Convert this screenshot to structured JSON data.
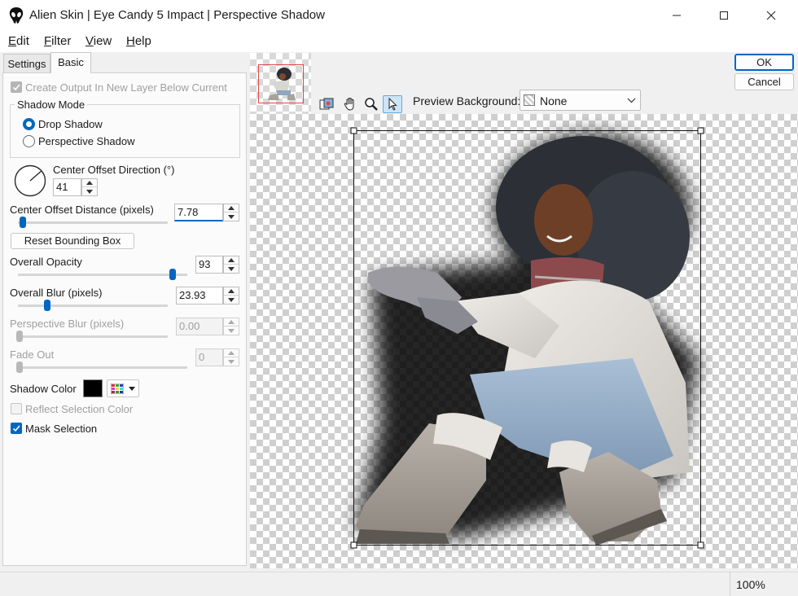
{
  "window": {
    "title": "Alien Skin | Eye Candy 5 Impact | Perspective Shadow"
  },
  "menu": [
    "Edit",
    "Filter",
    "View",
    "Help"
  ],
  "tabs": {
    "settings": "Settings",
    "basic": "Basic"
  },
  "controls": {
    "create_output_label": "Create Output In New Layer Below Current",
    "shadow_mode": {
      "label": "Shadow Mode",
      "options": [
        "Drop Shadow",
        "Perspective Shadow"
      ],
      "selected": "Drop Shadow"
    },
    "center_offset_direction": {
      "label": "Center Offset Direction (°)",
      "value": "41"
    },
    "center_offset_distance": {
      "label": "Center Offset Distance (pixels)",
      "value": "7.78",
      "slider_fraction": 0.08
    },
    "reset_bounding_box": "Reset Bounding Box",
    "overall_opacity": {
      "label": "Overall Opacity",
      "value": "93",
      "slider_fraction": 0.93
    },
    "overall_blur": {
      "label": "Overall Blur (pixels)",
      "value": "23.93",
      "slider_fraction": 0.2
    },
    "perspective_blur": {
      "label": "Perspective Blur (pixels)",
      "value": "0.00",
      "slider_fraction": 0.0
    },
    "fade_out": {
      "label": "Fade Out",
      "value": "0",
      "slider_fraction": 0.0
    },
    "shadow_color": {
      "label": "Shadow Color",
      "color": "#000000"
    },
    "reflect_selection_color": "Reflect Selection Color",
    "mask_selection": "Mask Selection"
  },
  "dialog_buttons": {
    "ok": "OK",
    "cancel": "Cancel"
  },
  "preview": {
    "background_label": "Preview Background:",
    "background_value": "None"
  },
  "status": {
    "zoom": "100%"
  },
  "colors": {
    "accent": "#0067c0"
  }
}
